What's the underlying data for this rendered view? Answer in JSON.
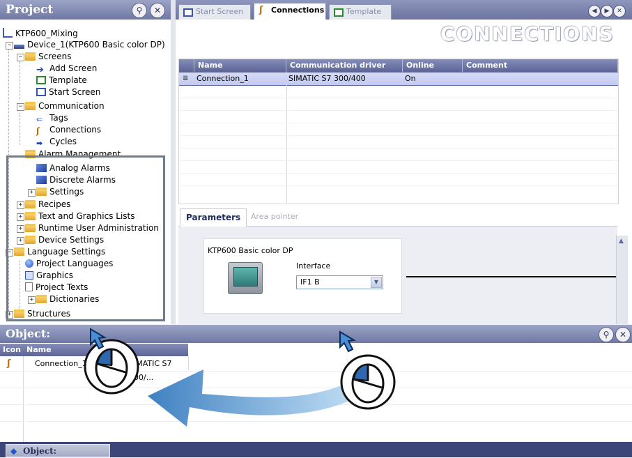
{
  "project": {
    "title": "Project",
    "tree": [
      {
        "label": "KTP600_Mixing"
      },
      {
        "label": "Device_1(KTP600 Basic color DP)"
      },
      {
        "label": "Screens"
      },
      {
        "label": "Add Screen"
      },
      {
        "label": "Template"
      },
      {
        "label": "Start Screen"
      },
      {
        "label": "Communication"
      },
      {
        "label": "Tags"
      },
      {
        "label": "Connections"
      },
      {
        "label": "Cycles"
      },
      {
        "label": "Alarm Management"
      },
      {
        "label": "Analog Alarms"
      },
      {
        "label": "Discrete Alarms"
      },
      {
        "label": "Settings"
      },
      {
        "label": "Recipes"
      },
      {
        "label": "Text and Graphics Lists"
      },
      {
        "label": "Runtime User Administration"
      },
      {
        "label": "Device Settings"
      },
      {
        "label": "Language Settings"
      },
      {
        "label": "Project Languages"
      },
      {
        "label": "Graphics"
      },
      {
        "label": "Project Texts"
      },
      {
        "label": "Dictionaries"
      },
      {
        "label": "Structures"
      }
    ]
  },
  "editor": {
    "tabs": [
      {
        "label": "Start Screen"
      },
      {
        "label": "Connections"
      },
      {
        "label": "Template"
      }
    ],
    "title": "CONNECTIONS",
    "columns": [
      "Name",
      "Communication driver",
      "Online",
      "Comment"
    ],
    "rows": [
      {
        "name": "Connection_1",
        "driver": "SIMATIC S7 300/400",
        "online": "On",
        "comment": ""
      }
    ],
    "param_tabs": [
      "Parameters",
      "Area pointer"
    ],
    "device_name": "KTP600 Basic color DP",
    "interface_label": "Interface",
    "interface_value": "IF1 B"
  },
  "object": {
    "title": "Object:",
    "columns": [
      "Icon",
      "Name"
    ],
    "row": {
      "name": "Connection_1",
      "detail": "SIMATIC S7 300/..."
    },
    "taskbar_label": "Object:"
  },
  "colors": {
    "header_blue": "#6f78a4",
    "drag_arrow": "#4a8cc8",
    "highlight": "#6f7c8a"
  }
}
